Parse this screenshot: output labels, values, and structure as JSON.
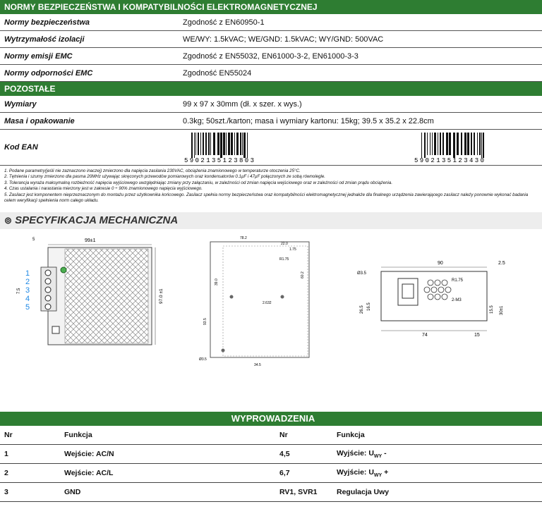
{
  "section_safety": {
    "title": "NORMY BEZPIECZEŃSTWA I KOMPATYBILNOŚCI ELEKTROMAGNETYCZNEJ",
    "rows": [
      {
        "k": "Normy bezpieczeństwa",
        "v": "Zgodność z EN60950-1"
      },
      {
        "k": "Wytrzymałość izolacji",
        "v": "WE/WY: 1.5kVAC; WE/GND: 1.5kVAC; WY/GND: 500VAC"
      },
      {
        "k": "Normy emisji EMC",
        "v": "Zgodność z EN55032, EN61000-3-2, EN61000-3-3"
      },
      {
        "k": "Normy odporności EMC",
        "v": "Zgodność  EN55024"
      }
    ]
  },
  "section_other": {
    "title": "POZOSTAŁE",
    "rows": [
      {
        "k": "Wymiary",
        "v": "99 x 97 x 30mm (dł. x szer. x wys.)"
      },
      {
        "k": "Masa i opakowanie",
        "v": "0.3kg; 50szt./karton; masa i wymiary kartonu: 15kg; 39.5 x 35.2 x 22.8cm"
      }
    ],
    "ean_label": "Kod EAN",
    "ean1": "5902135123803",
    "ean2": "5902135123430"
  },
  "notes": [
    "1. Podane parametry(jeśli nie zaznaczono inaczej) zmierzono dla napięcia zasilania 230VAC, obciążenia  znamionowego w temperaturze otoczenia  25°C.",
    "2. Tętnienia i szumy zmierzono dla pasma 20MHz używając skręconych przewodów pomiarowych oraz kondensatorów 0.1µF i 47µF połączonych ze sobą równolegle.",
    "3. Tolerancja wyraża maksymalną rozbieżność napięcia wyjściowego uwzględniając zmiany przy załączaniu, w zależności od zmian napięcia wejściowego oraz w zależności od zmian prądu obciążenia.",
    "4. Czas ustalania i narastania mierzony jest w zakresie 0 ÷ 90% znamionowego napięcia wyjściowego.",
    "5. Zasilacz jest komponentem nieprzeznaczonym do montażu przez użytkownika końcowego. Zasilacz spełnia normy bezpieczeństwa oraz kompatybilności elektromagnetycznej jednakże dla finalnego urządzenia zawierającego zasilacz należy ponownie wykonać badania celem weryfikacji spełnienia norm całego układu."
  ],
  "mech_title": "SPECYFIKACJA MECHANICZNA",
  "dims": {
    "d1_width": "99±1",
    "d1_height": "97.0 ±1",
    "d1_top": "5",
    "d1_side": "7.5",
    "d1_terminals": [
      "1",
      "2",
      "3",
      "4",
      "5"
    ],
    "d2_a": "78.2",
    "d2_b": "22.0",
    "d2_c": "1.75",
    "d2_d": "R1.75",
    "d2_e": "60.2",
    "d2_f": "39.0",
    "d2_g": "93.5",
    "d2_h": "2.632",
    "d2_i": "34.5",
    "d2_j": "Ø3.5",
    "d3_a": "90",
    "d3_b": "2.5",
    "d3_c": "Ø3.5",
    "d3_d": "R1.75",
    "d3_e": "2-M3",
    "d3_f": "26.5",
    "d3_g": "16.5",
    "d3_h": "15.5",
    "d3_i": "30±1",
    "d3_j": "74",
    "d3_k": "15"
  },
  "pins": {
    "title": "WYPROWADZENIA",
    "headers": [
      "Nr",
      "Funkcja",
      "Nr",
      "Funkcja"
    ],
    "rows": [
      {
        "n1": "1",
        "f1": "Wejście: AC/N",
        "n2": "4,5",
        "f2": "Wyjście: U",
        "f2_sub": "WY",
        "f2_suf": " -"
      },
      {
        "n1": "2",
        "f1": "Wejście: AC/L",
        "n2": "6,7",
        "f2": "Wyjście: U",
        "f2_sub": "WY",
        "f2_suf": " +"
      },
      {
        "n1": "3",
        "f1": "GND",
        "n2": "RV1, SVR1",
        "f2": "Regulacja Uwy",
        "f2_sub": "",
        "f2_suf": ""
      }
    ]
  }
}
